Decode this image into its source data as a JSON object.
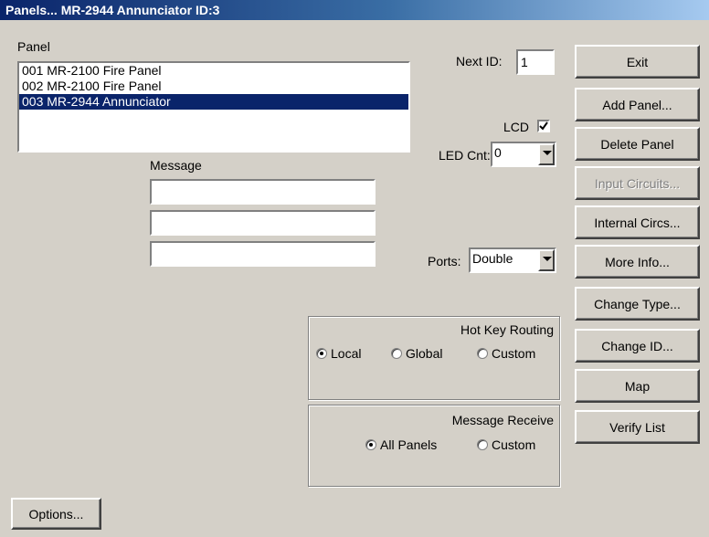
{
  "window": {
    "title": "Panels... MR-2944 Annunciator ID:3"
  },
  "panel": {
    "label": "Panel",
    "items": [
      {
        "text": "001 MR-2100 Fire Panel",
        "selected": false
      },
      {
        "text": "002 MR-2100 Fire Panel",
        "selected": false
      },
      {
        "text": "003 MR-2944 Annunciator",
        "selected": true
      }
    ]
  },
  "message": {
    "label": "Message",
    "lines": [
      "",
      "",
      ""
    ]
  },
  "next_id": {
    "label": "Next ID:",
    "value": "1"
  },
  "lcd": {
    "label": "LCD",
    "checked": true
  },
  "led_cnt": {
    "label": "LED Cnt:",
    "value": "0"
  },
  "ports": {
    "label": "Ports:",
    "value": "Double"
  },
  "hot_key": {
    "title": "Hot Key Routing",
    "options": [
      {
        "label": "Local",
        "selected": true
      },
      {
        "label": "Global",
        "selected": false
      },
      {
        "label": "Custom",
        "selected": false
      }
    ]
  },
  "message_receive": {
    "title": "Message Receive",
    "options": [
      {
        "label": "All Panels",
        "selected": true
      },
      {
        "label": "Custom",
        "selected": false
      }
    ]
  },
  "buttons": {
    "exit": "Exit",
    "add_panel": "Add Panel...",
    "delete_panel": "Delete Panel",
    "input_circuits": "Input Circuits...",
    "internal_circs": "Internal Circs...",
    "more_info": "More Info...",
    "change_type": "Change Type...",
    "change_id": "Change ID...",
    "map": "Map",
    "verify_list": "Verify List",
    "options": "Options..."
  },
  "colors": {
    "selection": "#0a246a",
    "face": "#d4d0c8"
  }
}
